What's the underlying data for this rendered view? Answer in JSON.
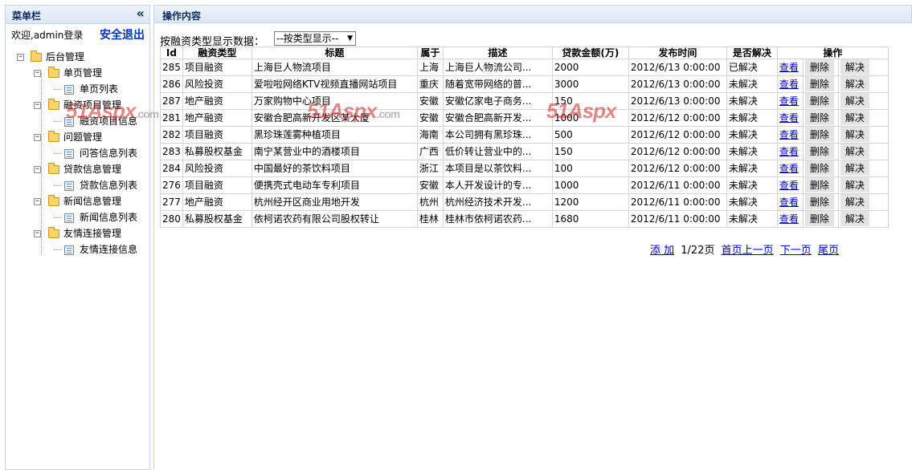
{
  "sidebar": {
    "title": "菜单栏",
    "collapse_icon": "«",
    "welcome": "欢迎,admin登录",
    "logout": "安全退出",
    "tree": [
      {
        "label": "后台管理",
        "children": [
          {
            "label": "单页管理",
            "children": [
              "单页列表"
            ]
          },
          {
            "label": "融资项目管理",
            "children": [
              "融资项目信息"
            ]
          },
          {
            "label": "问题管理",
            "children": [
              "问答信息列表"
            ]
          },
          {
            "label": "贷款信息管理",
            "children": [
              "贷款信息列表"
            ]
          },
          {
            "label": "新闻信息管理",
            "children": [
              "新闻信息列表"
            ]
          },
          {
            "label": "友情连接管理",
            "children": [
              "友情连接信息"
            ]
          }
        ]
      }
    ]
  },
  "main": {
    "title": "操作内容",
    "filter_label": "按融资类型显示数据：",
    "filter_selected": "--按类型显示--"
  },
  "table": {
    "headers": [
      "Id",
      "融资类型",
      "标题",
      "属于",
      "描述",
      "贷款金额(万)",
      "发布时间",
      "是否解决",
      "操作"
    ],
    "action_view": "查看",
    "action_delete": "删除",
    "action_resolve": "解决",
    "rows": [
      {
        "id": "285",
        "type": "项目融资",
        "title": "上海巨人物流项目",
        "region": "上海",
        "desc": "上海巨人物流公司...",
        "amount": "2000",
        "date": "2012/6/13 0:00:00",
        "status": "已解决"
      },
      {
        "id": "286",
        "type": "风险投资",
        "title": "爱啦啦网络KTV视频直播网站项目",
        "region": "重庆",
        "desc": "随着宽带网络的普...",
        "amount": "3000",
        "date": "2012/6/13 0:00:00",
        "status": "未解决"
      },
      {
        "id": "287",
        "type": "地产融资",
        "title": "万家购物中心项目",
        "region": "安徽",
        "desc": "安徽亿家电子商务...",
        "amount": "150",
        "date": "2012/6/13 0:00:00",
        "status": "未解决"
      },
      {
        "id": "281",
        "type": "地产融资",
        "title": "安徽合肥高新开发区某大厦",
        "region": "安徽",
        "desc": "安徽合肥高新开发...",
        "amount": "1000",
        "date": "2012/6/12 0:00:00",
        "status": "未解决"
      },
      {
        "id": "282",
        "type": "项目融资",
        "title": "黑珍珠莲雾种植项目",
        "region": "海南",
        "desc": "本公司拥有黑珍珠...",
        "amount": "500",
        "date": "2012/6/12 0:00:00",
        "status": "未解决"
      },
      {
        "id": "283",
        "type": "私募股权基金",
        "title": "南宁某营业中的酒楼项目",
        "region": "广西",
        "desc": "低价转让营业中的...",
        "amount": "150",
        "date": "2012/6/12 0:00:00",
        "status": "未解决"
      },
      {
        "id": "284",
        "type": "风险投资",
        "title": "中国最好的茶饮料项目",
        "region": "浙江",
        "desc": "本项目是以茶饮料...",
        "amount": "100",
        "date": "2012/6/12 0:00:00",
        "status": "未解决"
      },
      {
        "id": "276",
        "type": "项目融资",
        "title": "便携壳式电动车专利项目",
        "region": "安徽",
        "desc": "本人开发设计的专...",
        "amount": "1000",
        "date": "2012/6/11 0:00:00",
        "status": "未解决"
      },
      {
        "id": "277",
        "type": "地产融资",
        "title": "杭州经开区商业用地开发",
        "region": "杭州",
        "desc": "杭州经济技术开发...",
        "amount": "1200",
        "date": "2012/6/11 0:00:00",
        "status": "未解决"
      },
      {
        "id": "280",
        "type": "私募股权基金",
        "title": "依柯诺农药有限公司股权转让",
        "region": "桂林",
        "desc": "桂林市依柯诺农药...",
        "amount": "1680",
        "date": "2012/6/11 0:00:00",
        "status": "未解决"
      }
    ]
  },
  "pager": {
    "add": "添 加",
    "page_info": "1/22页",
    "first_prev": "首页上一页",
    "next": "下一页",
    "last": "尾页"
  },
  "watermark": "51Aspx"
}
